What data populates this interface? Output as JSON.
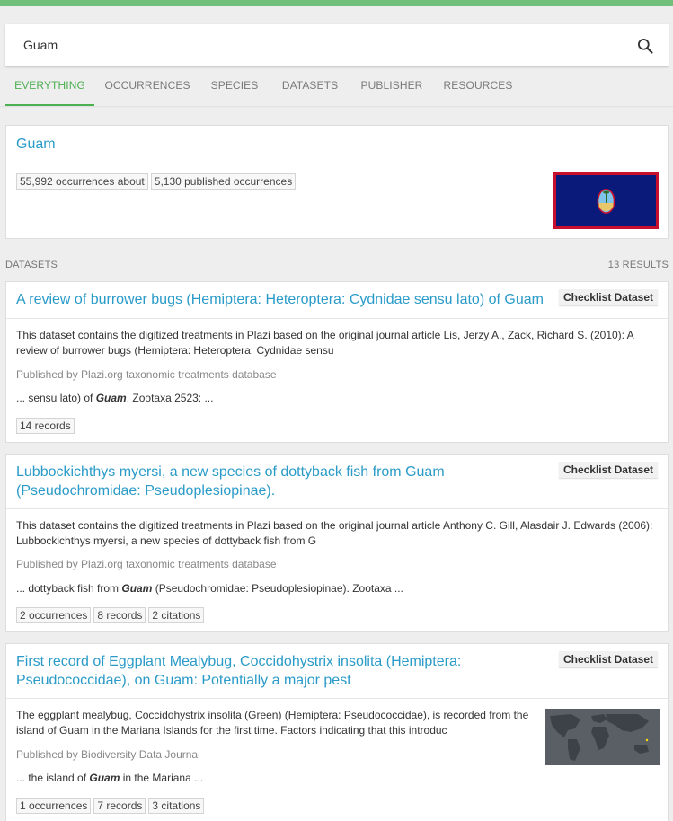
{
  "search": {
    "query": "Guam"
  },
  "tabs": [
    "EVERYTHING",
    "OCCURRENCES",
    "SPECIES",
    "DATASETS",
    "PUBLISHER",
    "RESOURCES"
  ],
  "country": {
    "title": "Guam",
    "chips": [
      "55,992 occurrences about",
      "5,130 published occurrences"
    ],
    "flag_colors": {
      "border": "#c8102e",
      "field": "#0a1a7a"
    }
  },
  "datasets_section": {
    "label": "DATASETS",
    "count": "13 RESULTS"
  },
  "results": [
    {
      "title": "A review of burrower bugs (Hemiptera: Heteroptera: Cydnidae sensu lato) of Guam",
      "badge": "Checklist Dataset",
      "description": "This dataset contains the digitized treatments in Plazi based on the original journal article Lis, Jerzy A., Zack, Richard S. (2010): A review of burrower bugs (Hemiptera: Heteroptera: Cydnidae sensu",
      "publisher": "Published by Plazi.org taxonomic treatments database",
      "snippet_pre": "... sensu lato) of ",
      "snippet_em": "Guam",
      "snippet_post": ". Zootaxa 2523: ...",
      "chips": [
        "14 records"
      ]
    },
    {
      "title": "Lubbockichthys myersi, a new species of dottyback fish from Guam (Pseudochromidae: Pseudoplesiopinae).",
      "badge": "Checklist Dataset",
      "description": "This dataset contains the digitized treatments in Plazi based on the original journal article Anthony C. Gill, Alasdair J. Edwards (2006): Lubbockichthys myersi, a new species of dottyback fish from G",
      "publisher": "Published by Plazi.org taxonomic treatments database",
      "snippet_pre": "... dottyback fish from ",
      "snippet_em": "Guam",
      "snippet_post": " (Pseudochromidae: Pseudoplesiopinae). Zootaxa ...",
      "chips": [
        "2 occurrences",
        "8 records",
        "2 citations"
      ]
    },
    {
      "title": "First record of Eggplant Mealybug, Coccidohystrix insolita (Hemiptera: Pseudococcidae), on Guam: Potentially a major pest",
      "badge": "Checklist Dataset",
      "description": "The eggplant mealybug, Coccidohystrix insolita (Green) (Hemiptera: Pseudococcidae), is recorded from the island of Guam in the Mariana Islands for the first time. Factors indicating that this introduc",
      "publisher": "Published by Biodiversity Data Journal",
      "snippet_pre": "... the island of ",
      "snippet_em": "Guam",
      "snippet_post": " in the Mariana ...",
      "chips": [
        "1 occurrences",
        "7 records",
        "3 citations"
      ]
    }
  ]
}
